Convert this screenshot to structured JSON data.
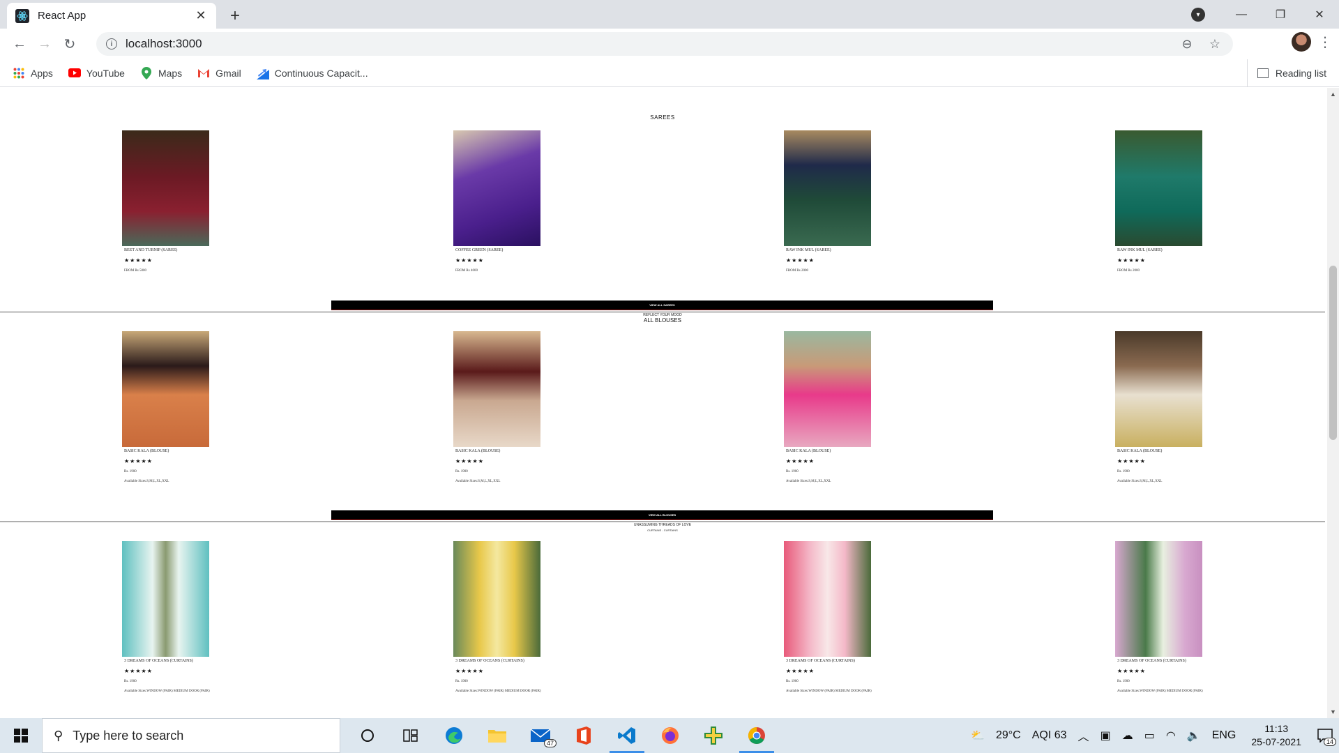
{
  "browser": {
    "tab_title": "React App",
    "url": "localhost:3000",
    "bookmarks": [
      "Apps",
      "YouTube",
      "Maps",
      "Gmail",
      "Continuous Capacit..."
    ],
    "reading_list": "Reading list"
  },
  "sarees": {
    "title": "SAREES",
    "items": [
      {
        "name": "BEET AND TURNIP (SAREE)",
        "stars": "★★★★★",
        "price": "FROM Rs 5000",
        "color": "#6b1a24"
      },
      {
        "name": "COFFEE GREEN (SAREE)",
        "stars": "★★★★★",
        "price": "FROM Rs 4000",
        "color": "#4a1f8c"
      },
      {
        "name": "RAW INK MUL (SAREE)",
        "stars": "★★★★★",
        "price": "FROM Rs 2000",
        "color": "#1f4a38"
      },
      {
        "name": "RAW INK MUL (SAREE)",
        "stars": "★★★★★",
        "price": "FROM Rs 2000",
        "color": "#1f7a6a"
      }
    ],
    "view_all": "VIEW ALL SAREES"
  },
  "blouses": {
    "subtitle": "REFLECT YOUR MOOD",
    "title": "ALL BLOUSES",
    "items": [
      {
        "name": "BASIC KALA (BLOUSE)",
        "stars": "★★★★★",
        "price": "Rs. 1900",
        "sizes": "Available Sizes:S,M,L,XL,XXL",
        "color": "#d9804a"
      },
      {
        "name": "BASIC KALA (BLOUSE)",
        "stars": "★★★★★",
        "price": "Rs. 1900",
        "sizes": "Available Sizes:S,M,L,XL,XXL",
        "color": "#c9a890"
      },
      {
        "name": "BASIC KALA (BLOUSE)",
        "stars": "★★★★★",
        "price": "Rs. 1900",
        "sizes": "Available Sizes:S,M,L,XL,XXL",
        "color": "#e86aa0"
      },
      {
        "name": "BASIC KALA (BLOUSE)",
        "stars": "★★★★★",
        "price": "Rs. 1900",
        "sizes": "Available Sizes:S,M,L,XL,XXL",
        "color": "#c9b060"
      }
    ],
    "view_all": "VIEW ALL BLOUSES"
  },
  "curtains": {
    "subtitle": "UNASSUMING THREADS OF LOVE",
    "title": "CURTAINS - CURTAINS",
    "items": [
      {
        "name": "3 DREAMS OF OCEANS (CURTAINS)",
        "stars": "★★★★★",
        "price": "Rs. 1900",
        "sizes": "Available Sizes:WINDOW (PAIR) MEDIUM DOOR (PAIR)",
        "color": "#5fc0c0"
      },
      {
        "name": "3 DREAMS OF OCEANS (CURTAINS)",
        "stars": "★★★★★",
        "price": "Rs. 1900",
        "sizes": "Available Sizes:WINDOW (PAIR) MEDIUM DOOR (PAIR)",
        "color": "#e8c84a"
      },
      {
        "name": "3 DREAMS OF OCEANS (CURTAINS)",
        "stars": "★★★★★",
        "price": "Rs. 1900",
        "sizes": "Available Sizes:WINDOW (PAIR) MEDIUM DOOR (PAIR)",
        "color": "#e85a7a"
      },
      {
        "name": "3 DREAMS OF OCEANS (CURTAINS)",
        "stars": "★★★★★",
        "price": "Rs. 1900",
        "sizes": "Available Sizes:WINDOW (PAIR) MEDIUM DOOR (PAIR)",
        "color": "#d8a8d0"
      }
    ]
  },
  "taskbar": {
    "search_placeholder": "Type here to search",
    "weather": "29°C",
    "aqi": "AQI 63",
    "lang": "ENG",
    "time": "11:13",
    "date": "25-07-2021",
    "mail_badge": "47",
    "notif_badge": "14"
  }
}
